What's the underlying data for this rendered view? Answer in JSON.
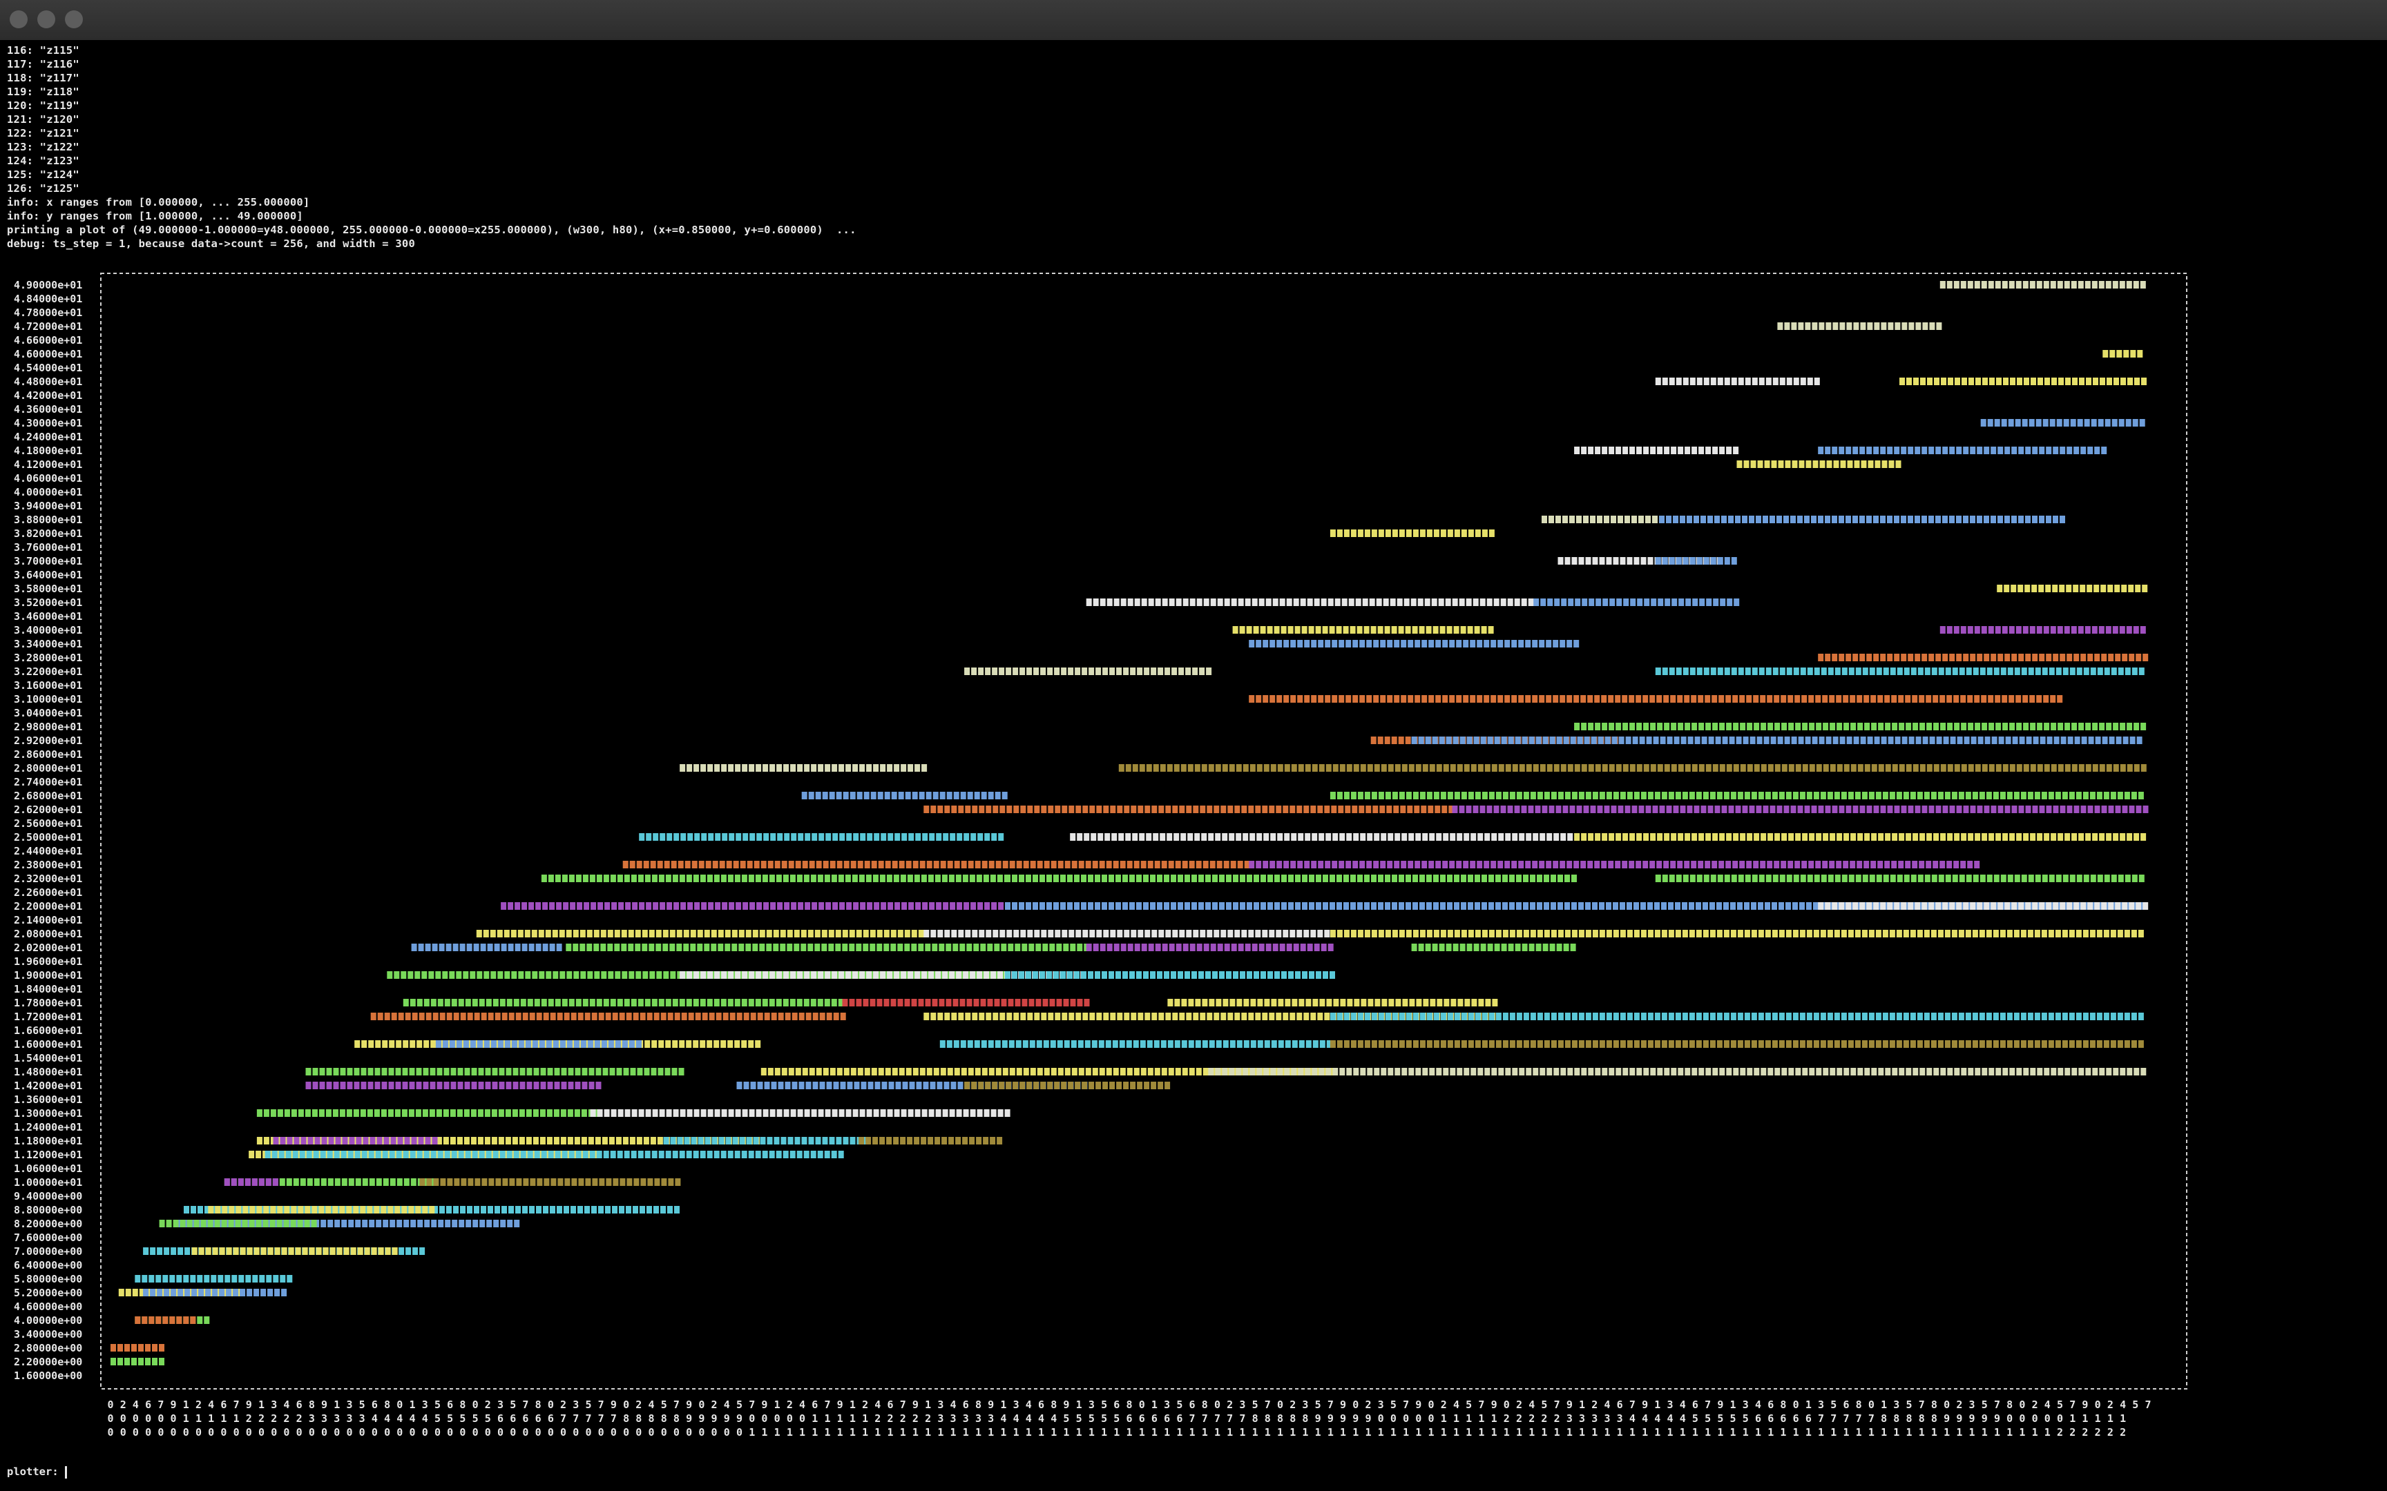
{
  "window": {
    "title": ""
  },
  "log_lines": [
    "116: \"z115\"",
    "117: \"z116\"",
    "118: \"z117\"",
    "119: \"z118\"",
    "120: \"z119\"",
    "121: \"z120\"",
    "122: \"z121\"",
    "123: \"z122\"",
    "124: \"z123\"",
    "125: \"z124\"",
    "126: \"z125\"",
    "info: x ranges from [0.000000, ... 255.000000]",
    "info: y ranges from [1.000000, ... 49.000000]",
    "printing a plot of (49.000000-1.000000=y48.000000, 255.000000-0.000000=x255.000000), (w300, h80), (x+=0.850000, y+=0.600000)  ...",
    "debug: ts_step = 1, because data->count = 256, and width = 300"
  ],
  "prompt": {
    "label": "plotter:"
  },
  "chart_data": {
    "type": "scatter",
    "glyph": "#",
    "x_range": [
      0,
      255
    ],
    "y_range": [
      1,
      49
    ],
    "y_tick_labels": [
      "4.90000e+01",
      "4.84000e+01",
      "4.78000e+01",
      "4.72000e+01",
      "4.66000e+01",
      "4.60000e+01",
      "4.54000e+01",
      "4.48000e+01",
      "4.42000e+01",
      "4.36000e+01",
      "4.30000e+01",
      "4.24000e+01",
      "4.18000e+01",
      "4.12000e+01",
      "4.06000e+01",
      "4.00000e+01",
      "3.94000e+01",
      "3.88000e+01",
      "3.82000e+01",
      "3.76000e+01",
      "3.70000e+01",
      "3.64000e+01",
      "3.58000e+01",
      "3.52000e+01",
      "3.46000e+01",
      "3.40000e+01",
      "3.34000e+01",
      "3.28000e+01",
      "3.22000e+01",
      "3.16000e+01",
      "3.10000e+01",
      "3.04000e+01",
      "2.98000e+01",
      "2.92000e+01",
      "2.86000e+01",
      "2.80000e+01",
      "2.74000e+01",
      "2.68000e+01",
      "2.62000e+01",
      "2.56000e+01",
      "2.50000e+01",
      "2.44000e+01",
      "2.38000e+01",
      "2.32000e+01",
      "2.26000e+01",
      "2.20000e+01",
      "2.14000e+01",
      "2.08000e+01",
      "2.02000e+01",
      "1.96000e+01",
      "1.90000e+01",
      "1.84000e+01",
      "1.78000e+01",
      "1.72000e+01",
      "1.66000e+01",
      "1.60000e+01",
      "1.54000e+01",
      "1.48000e+01",
      "1.42000e+01",
      "1.36000e+01",
      "1.30000e+01",
      "1.24000e+01",
      "1.18000e+01",
      "1.12000e+01",
      "1.06000e+01",
      "1.00000e+01",
      "9.40000e+00",
      "8.80000e+00",
      "8.20000e+00",
      "7.60000e+00",
      "7.00000e+00",
      "6.40000e+00",
      "5.80000e+00",
      "5.20000e+00",
      "4.60000e+00",
      "4.00000e+00",
      "3.40000e+00",
      "2.80000e+00",
      "2.20000e+00",
      "1.60000e+00"
    ],
    "x_tick_digits": [
      "0246791246791346891356801356802357802357902457902457912467912467913468913468913568013568023570235790235790245790245791246791346791346801356801357802357802457902457",
      "00000011111222223333344444555556666677777888889999900000111112222233333444445555566666777778888899999000001111122222333334444455555666667777788888999990000011111",
      "00000000000000000000000000000000000000000000000000011111111111111111111111111111111111111111111111111111111111111111111111111111111111111111111111111111111222222"
    ],
    "palette": {
      "white": "#e6e6e6",
      "cream": "#d9dcb8",
      "yellow": "#e6e069",
      "green": "#79d95a",
      "blue": "#6f9fdc",
      "cyan": "#5ac8d8",
      "purple": "#a050c0",
      "orange": "#d8733a",
      "olive": "#a08a3a",
      "red": "#d04444"
    },
    "series": [
      {
        "x": [
          0,
          6
        ],
        "y": 2.2,
        "color": "green"
      },
      {
        "x": [
          0,
          6
        ],
        "y": 2.8,
        "color": "orange"
      },
      {
        "x": [
          3,
          12
        ],
        "y": 4.0,
        "color": "green"
      },
      {
        "x": [
          3,
          10
        ],
        "y": 4.0,
        "color": "orange"
      },
      {
        "x": [
          1,
          16
        ],
        "y": 5.2,
        "color": "yellow"
      },
      {
        "x": [
          4,
          21
        ],
        "y": 5.2,
        "color": "blue"
      },
      {
        "x": [
          3,
          22
        ],
        "y": 5.8,
        "color": "cyan"
      },
      {
        "x": [
          4,
          38
        ],
        "y": 7.0,
        "color": "cyan"
      },
      {
        "x": [
          10,
          35
        ],
        "y": 7.0,
        "color": "yellow"
      },
      {
        "x": [
          8,
          50
        ],
        "y": 8.2,
        "color": "blue"
      },
      {
        "x": [
          6,
          25
        ],
        "y": 8.2,
        "color": "green"
      },
      {
        "x": [
          9,
          70
        ],
        "y": 8.8,
        "color": "cyan"
      },
      {
        "x": [
          12,
          40
        ],
        "y": 8.8,
        "color": "yellow"
      },
      {
        "x": [
          14,
          40
        ],
        "y": 10.0,
        "color": "green"
      },
      {
        "x": [
          14,
          20
        ],
        "y": 10.0,
        "color": "purple"
      },
      {
        "x": [
          38,
          70
        ],
        "y": 10.0,
        "color": "olive"
      },
      {
        "x": [
          17,
          60
        ],
        "y": 11.2,
        "color": "yellow"
      },
      {
        "x": [
          19,
          90
        ],
        "y": 11.2,
        "color": "cyan"
      },
      {
        "x": [
          18,
          80
        ],
        "y": 11.8,
        "color": "yellow"
      },
      {
        "x": [
          20,
          40
        ],
        "y": 11.8,
        "color": "purple"
      },
      {
        "x": [
          68,
          93
        ],
        "y": 11.8,
        "color": "cyan"
      },
      {
        "x": [
          92,
          109
        ],
        "y": 11.8,
        "color": "olive"
      },
      {
        "x": [
          18,
          60
        ],
        "y": 13.0,
        "color": "green"
      },
      {
        "x": [
          59,
          110
        ],
        "y": 13.0,
        "color": "white"
      },
      {
        "x": [
          24,
          60
        ],
        "y": 14.2,
        "color": "purple"
      },
      {
        "x": [
          77,
          120
        ],
        "y": 14.2,
        "color": "blue"
      },
      {
        "x": [
          105,
          130
        ],
        "y": 14.2,
        "color": "olive"
      },
      {
        "x": [
          24,
          70
        ],
        "y": 14.8,
        "color": "green"
      },
      {
        "x": [
          80,
          150
        ],
        "y": 14.8,
        "color": "yellow"
      },
      {
        "x": [
          135,
          250
        ],
        "y": 14.8,
        "color": "cream"
      },
      {
        "x": [
          30,
          80
        ],
        "y": 16.0,
        "color": "yellow"
      },
      {
        "x": [
          40,
          65
        ],
        "y": 16.0,
        "color": "blue"
      },
      {
        "x": [
          102,
          150
        ],
        "y": 16.0,
        "color": "cyan"
      },
      {
        "x": [
          150,
          250
        ],
        "y": 16.0,
        "color": "olive"
      },
      {
        "x": [
          32,
          90
        ],
        "y": 17.2,
        "color": "orange"
      },
      {
        "x": [
          100,
          170
        ],
        "y": 17.2,
        "color": "yellow"
      },
      {
        "x": [
          150,
          250
        ],
        "y": 17.2,
        "color": "cyan"
      },
      {
        "x": [
          36,
          90
        ],
        "y": 17.8,
        "color": "green"
      },
      {
        "x": [
          90,
          120
        ],
        "y": 17.8,
        "color": "red"
      },
      {
        "x": [
          130,
          170
        ],
        "y": 17.8,
        "color": "yellow"
      },
      {
        "x": [
          34,
          110
        ],
        "y": 19.0,
        "color": "green"
      },
      {
        "x": [
          70,
          120
        ],
        "y": 19.0,
        "color": "white"
      },
      {
        "x": [
          110,
          150
        ],
        "y": 19.0,
        "color": "cyan"
      },
      {
        "x": [
          37,
          55
        ],
        "y": 20.2,
        "color": "blue"
      },
      {
        "x": [
          56,
          120
        ],
        "y": 20.2,
        "color": "green"
      },
      {
        "x": [
          120,
          150
        ],
        "y": 20.2,
        "color": "purple"
      },
      {
        "x": [
          160,
          180
        ],
        "y": 20.2,
        "color": "green"
      },
      {
        "x": [
          45,
          100
        ],
        "y": 20.8,
        "color": "yellow"
      },
      {
        "x": [
          100,
          150
        ],
        "y": 20.8,
        "color": "white"
      },
      {
        "x": [
          150,
          250
        ],
        "y": 20.8,
        "color": "yellow"
      },
      {
        "x": [
          48,
          110
        ],
        "y": 22.0,
        "color": "purple"
      },
      {
        "x": [
          110,
          250
        ],
        "y": 22.0,
        "color": "blue"
      },
      {
        "x": [
          210,
          250
        ],
        "y": 22.0,
        "color": "white"
      },
      {
        "x": [
          53,
          110
        ],
        "y": 23.2,
        "color": "green"
      },
      {
        "x": [
          110,
          180
        ],
        "y": 23.2,
        "color": "green"
      },
      {
        "x": [
          190,
          250
        ],
        "y": 23.2,
        "color": "green"
      },
      {
        "x": [
          63,
          140
        ],
        "y": 23.8,
        "color": "orange"
      },
      {
        "x": [
          140,
          230
        ],
        "y": 23.8,
        "color": "purple"
      },
      {
        "x": [
          65,
          110
        ],
        "y": 25.0,
        "color": "cyan"
      },
      {
        "x": [
          118,
          180
        ],
        "y": 25.0,
        "color": "white"
      },
      {
        "x": [
          180,
          250
        ],
        "y": 25.0,
        "color": "yellow"
      },
      {
        "x": [
          100,
          165
        ],
        "y": 26.2,
        "color": "orange"
      },
      {
        "x": [
          165,
          250
        ],
        "y": 26.2,
        "color": "purple"
      },
      {
        "x": [
          85,
          110
        ],
        "y": 26.8,
        "color": "blue"
      },
      {
        "x": [
          150,
          250
        ],
        "y": 26.8,
        "color": "green"
      },
      {
        "x": [
          70,
          100
        ],
        "y": 28.0,
        "color": "cream"
      },
      {
        "x": [
          124,
          250
        ],
        "y": 28.0,
        "color": "olive"
      },
      {
        "x": [
          155,
          185
        ],
        "y": 29.2,
        "color": "orange"
      },
      {
        "x": [
          160,
          250
        ],
        "y": 29.2,
        "color": "blue"
      },
      {
        "x": [
          180,
          250
        ],
        "y": 29.8,
        "color": "green"
      },
      {
        "x": [
          140,
          240
        ],
        "y": 31.0,
        "color": "orange"
      },
      {
        "x": [
          190,
          250
        ],
        "y": 32.2,
        "color": "cyan"
      },
      {
        "x": [
          210,
          250
        ],
        "y": 32.8,
        "color": "orange"
      },
      {
        "x": [
          105,
          135
        ],
        "y": 32.2,
        "color": "cream"
      },
      {
        "x": [
          140,
          180
        ],
        "y": 33.4,
        "color": "blue"
      },
      {
        "x": [
          225,
          250
        ],
        "y": 34.0,
        "color": "purple"
      },
      {
        "x": [
          138,
          170
        ],
        "y": 34.0,
        "color": "yellow"
      },
      {
        "x": [
          120,
          175
        ],
        "y": 35.2,
        "color": "white"
      },
      {
        "x": [
          175,
          200
        ],
        "y": 35.2,
        "color": "blue"
      },
      {
        "x": [
          232,
          250
        ],
        "y": 35.8,
        "color": "yellow"
      },
      {
        "x": [
          178,
          198
        ],
        "y": 37.0,
        "color": "white"
      },
      {
        "x": [
          190,
          200
        ],
        "y": 37.0,
        "color": "blue"
      },
      {
        "x": [
          150,
          170
        ],
        "y": 38.2,
        "color": "yellow"
      },
      {
        "x": [
          176,
          240
        ],
        "y": 38.8,
        "color": "blue"
      },
      {
        "x": [
          176,
          190
        ],
        "y": 38.8,
        "color": "cream"
      },
      {
        "x": [
          200,
          220
        ],
        "y": 41.2,
        "color": "yellow"
      },
      {
        "x": [
          210,
          245
        ],
        "y": 41.8,
        "color": "blue"
      },
      {
        "x": [
          180,
          200
        ],
        "y": 41.8,
        "color": "white"
      },
      {
        "x": [
          230,
          250
        ],
        "y": 43.0,
        "color": "blue"
      },
      {
        "x": [
          190,
          210
        ],
        "y": 44.8,
        "color": "white"
      },
      {
        "x": [
          220,
          250
        ],
        "y": 44.8,
        "color": "yellow"
      },
      {
        "x": [
          245,
          250
        ],
        "y": 46.0,
        "color": "yellow"
      },
      {
        "x": [
          205,
          225
        ],
        "y": 47.2,
        "color": "cream"
      },
      {
        "x": [
          225,
          250
        ],
        "y": 49.0,
        "color": "cream"
      }
    ]
  }
}
